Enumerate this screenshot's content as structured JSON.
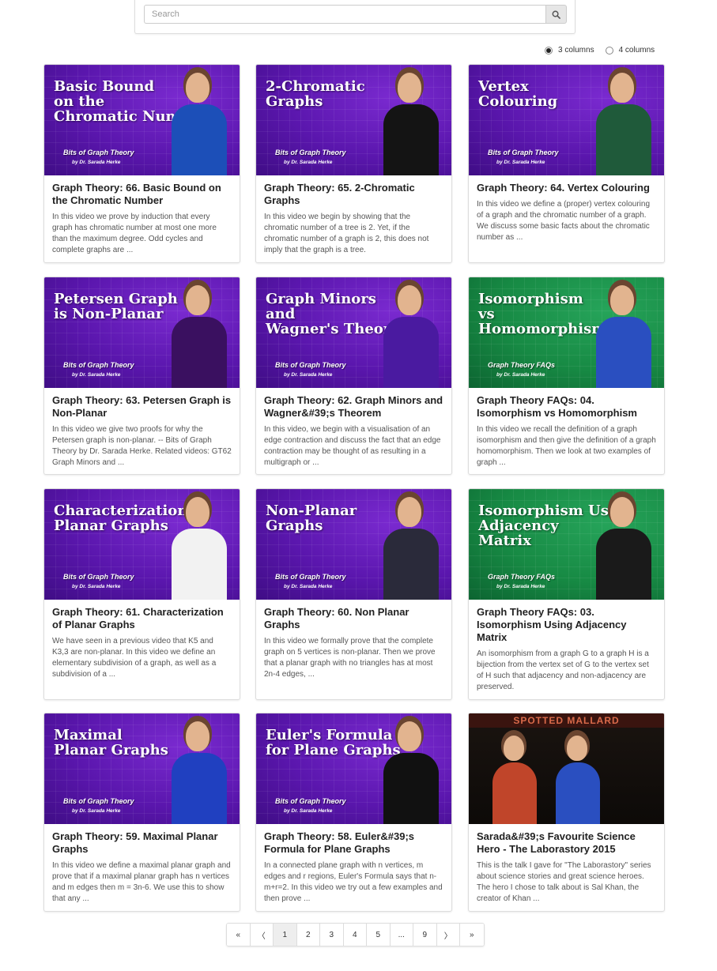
{
  "search": {
    "placeholder": "Search"
  },
  "columns": {
    "option3": "3 columns",
    "option4": "4 columns",
    "selected": "3 columns"
  },
  "colors": {
    "purple": "#5a16ad",
    "green": "#178a44"
  },
  "cards": [
    {
      "thumb_text": "Basic Bound\non the\nChromatic Number",
      "series": "Bits of Graph Theory",
      "byline": "by Dr. Sarada Herke",
      "theme": "purple",
      "shirt": "#1c4fb8",
      "title": "Graph Theory: 66. Basic Bound on the Chromatic Number",
      "desc": "In this video we prove by induction that every graph has chromatic number at most one more than the maximum degree. Odd cycles and complete graphs are ..."
    },
    {
      "thumb_text": "2-Chromatic\nGraphs",
      "series": "Bits of Graph Theory",
      "byline": "by Dr. Sarada Herke",
      "theme": "purple",
      "shirt": "#141414",
      "title": "Graph Theory: 65. 2-Chromatic Graphs",
      "desc": "In this video we begin by showing that the chromatic number of a tree is 2. Yet, if the chromatic number of a graph is 2, this does not imply that the graph is a tree."
    },
    {
      "thumb_text": "Vertex\nColouring",
      "series": "Bits of Graph Theory",
      "byline": "by Dr. Sarada Herke",
      "theme": "purple",
      "shirt": "#1f5a3a",
      "title": "Graph Theory: 64. Vertex Colouring",
      "desc": "In this video we define a (proper) vertex colouring of a graph and the chromatic number of a graph. We discuss some basic facts about the chromatic number as ..."
    },
    {
      "thumb_text": "Petersen Graph\nis Non-Planar",
      "series": "Bits of Graph Theory",
      "byline": "by Dr. Sarada Herke",
      "theme": "purple",
      "shirt": "#3a1060",
      "title": "Graph Theory: 63. Petersen Graph is Non-Planar",
      "desc": "In this video we give two proofs for why the Petersen graph is non-planar. -- Bits of Graph Theory by Dr. Sarada Herke. Related videos: GT62 Graph Minors and ..."
    },
    {
      "thumb_text": "Graph Minors\nand\nWagner's Theorem",
      "series": "Bits of Graph Theory",
      "byline": "by Dr. Sarada Herke",
      "theme": "purple",
      "shirt": "#4a1aa0",
      "title": "Graph Theory: 62. Graph Minors and Wagner&#39;s Theorem",
      "desc": "In this video, we begin with a visualisation of an edge contraction and discuss the fact that an edge contraction may be thought of as resulting in a multigraph or ..."
    },
    {
      "thumb_text": "Isomorphism\nvs\nHomomorphism",
      "series": "Graph Theory FAQs",
      "byline": "by Dr. Sarada Herke",
      "theme": "green",
      "shirt": "#2a4fc0",
      "title": "Graph Theory FAQs: 04. Isomorphism vs Homomorphism",
      "desc": "In this video we recall the definition of a graph isomorphism and then give the definition of a graph homomorphism. Then we look at two examples of graph ..."
    },
    {
      "thumb_text": "Characterization of\nPlanar Graphs",
      "series": "Bits of Graph Theory",
      "byline": "by Dr. Sarada Herke",
      "theme": "purple",
      "shirt": "#f2f2f2",
      "title": "Graph Theory: 61. Characterization of Planar Graphs",
      "desc": "We have seen in a previous video that K5 and K3,3 are non-planar. In this video we define an elementary subdivision of a graph, as well as a subdivision of a ..."
    },
    {
      "thumb_text": "Non-Planar\nGraphs",
      "series": "Bits of Graph Theory",
      "byline": "by Dr. Sarada Herke",
      "theme": "purple",
      "shirt": "#2a2a3a",
      "title": "Graph Theory: 60. Non Planar Graphs",
      "desc": "In this video we formally prove that the complete graph on 5 vertices is non-planar. Then we prove that a planar graph with no triangles has at most 2n-4 edges, ..."
    },
    {
      "thumb_text": "Isomorphism Using\nAdjacency\nMatrix",
      "series": "Graph Theory FAQs",
      "byline": "by Dr. Sarada Herke",
      "theme": "green",
      "shirt": "#1a1a1a",
      "title": "Graph Theory FAQs: 03. Isomorphism Using Adjacency Matrix",
      "desc": "An isomorphism from a graph G to a graph H is a bijection from the vertex set of G to the vertex set of H such that adjacency and non-adjacency are preserved."
    },
    {
      "thumb_text": "Maximal\nPlanar Graphs",
      "series": "Bits of Graph Theory",
      "byline": "by Dr. Sarada Herke",
      "theme": "purple",
      "shirt": "#2040c0",
      "title": "Graph Theory: 59. Maximal Planar Graphs",
      "desc": "In this video we define a maximal planar graph and prove that if a maximal planar graph has n vertices and m edges then m = 3n-6. We use this to show that any ..."
    },
    {
      "thumb_text": "Euler's Formula\nfor Plane Graphs",
      "series": "Bits of Graph Theory",
      "byline": "by Dr. Sarada Herke",
      "theme": "purple",
      "shirt": "#111111",
      "title": "Graph Theory: 58. Euler&#39;s Formula for Plane Graphs",
      "desc": "In a connected plane graph with n vertices, m edges and r regions, Euler's Formula says that n-m+r=2. In this video we try out a few examples and then prove ..."
    },
    {
      "thumb_text": "",
      "stage_sign": "SPOTTED MALLARD",
      "theme": "dark",
      "shirt": "#2a4fc0",
      "title": "Sarada&#39;s Favourite Science Hero - The Laborastory 2015",
      "desc": "This is the talk I gave for \"The Laborastory\" series about science stories and great science heroes. The hero I chose to talk about is Sal Khan, the creator of Khan ..."
    }
  ],
  "pagination": [
    "«",
    "〈",
    "1",
    "2",
    "3",
    "4",
    "5",
    "...",
    "9",
    "〉",
    "»"
  ],
  "current_page": "1"
}
